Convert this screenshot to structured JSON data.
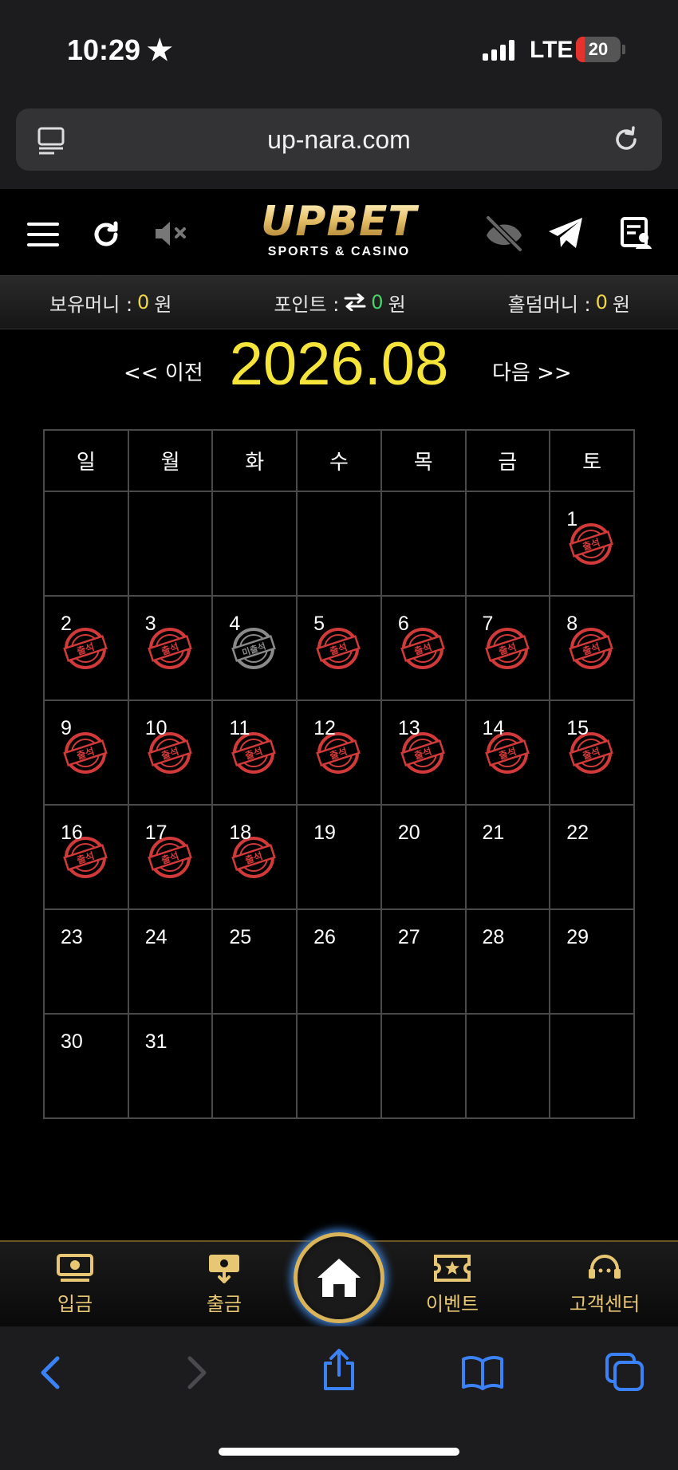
{
  "status_bar": {
    "time": "10:29",
    "network": "LTE",
    "battery": "20",
    "battery_level": 0.2
  },
  "browser": {
    "url": "up-nara.com"
  },
  "header": {
    "logo_main": "UPBET",
    "logo_sub": "SPORTS & CASINO"
  },
  "balance": {
    "money_label": "보유머니 :",
    "money_value": "0",
    "money_unit": "원",
    "point_label": "포인트 :",
    "point_value": "0",
    "point_unit": "원",
    "holdem_label": "홀덤머니 :",
    "holdem_value": "0",
    "holdem_unit": "원"
  },
  "calendar": {
    "prev_label": "<< 이전",
    "next_label": "다음 >>",
    "month_title": "2026.08",
    "weekdays": [
      "일",
      "월",
      "화",
      "수",
      "목",
      "금",
      "토"
    ],
    "attended_label": "출석",
    "absent_label": "미출석",
    "weeks": [
      [
        "",
        "",
        "",
        "",
        "",
        "",
        "1"
      ],
      [
        "2",
        "3",
        "4",
        "5",
        "6",
        "7",
        "8"
      ],
      [
        "9",
        "10",
        "11",
        "12",
        "13",
        "14",
        "15"
      ],
      [
        "16",
        "17",
        "18",
        "19",
        "20",
        "21",
        "22"
      ],
      [
        "23",
        "24",
        "25",
        "26",
        "27",
        "28",
        "29"
      ],
      [
        "30",
        "31",
        "",
        "",
        "",
        "",
        ""
      ]
    ],
    "stamps": {
      "1": "attended",
      "2": "attended",
      "3": "attended",
      "4": "absent",
      "5": "attended",
      "6": "attended",
      "7": "attended",
      "8": "attended",
      "9": "attended",
      "10": "attended",
      "11": "attended",
      "12": "attended",
      "13": "attended",
      "14": "attended",
      "15": "attended",
      "16": "attended",
      "17": "attended",
      "18": "attended"
    }
  },
  "bottom_nav": {
    "deposit": "입금",
    "withdraw": "출금",
    "event": "이벤트",
    "support": "고객센터"
  },
  "colors": {
    "accent_gold": "#d9b45a",
    "month_yellow": "#f5e53a",
    "stamp_red": "#d23a3a",
    "stamp_gray": "#8a8a8a",
    "safari_blue": "#3b82f6"
  }
}
